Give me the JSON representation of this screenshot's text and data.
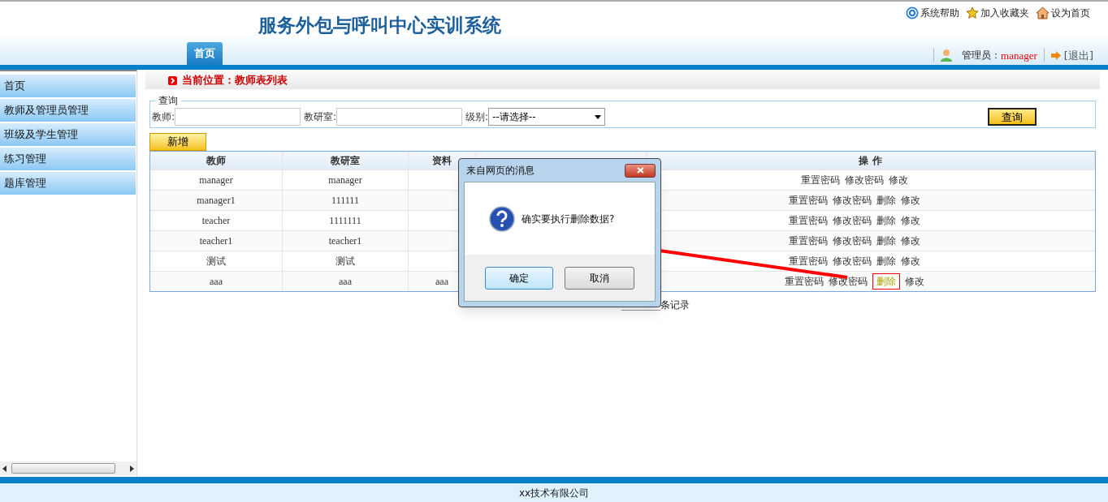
{
  "header": {
    "title": "服务外包与呼叫中心实训系统",
    "links": [
      {
        "label": "系统帮助",
        "kind": "help"
      },
      {
        "label": "加入收藏夹",
        "kind": "favorite"
      },
      {
        "label": "设为首页",
        "kind": "homepage"
      }
    ]
  },
  "tabs": [
    {
      "label": "首页",
      "selected": true
    }
  ],
  "user": {
    "role": "管理员：",
    "name": "manager",
    "logout": "[退出]"
  },
  "sidebar": {
    "items": [
      "首页",
      "教师及管理员管理",
      "班级及学生管理",
      "练习管理",
      "题库管理"
    ]
  },
  "breadcrumb": "当前位置：教师表列表",
  "query": {
    "legend": "查询",
    "fields": [
      {
        "label": "教师:",
        "kind": "text"
      },
      {
        "label": "教研室:",
        "kind": "text"
      },
      {
        "label": "级别:",
        "kind": "select",
        "value": "--请选择--"
      }
    ],
    "button": "查询"
  },
  "add_button": "新增",
  "table": {
    "columns": [
      {
        "kind": "text",
        "label": "教师"
      },
      {
        "kind": "text",
        "label": "教研室"
      },
      {
        "kind": "text",
        "label": "资料"
      },
      {
        "kind": "covered"
      },
      {
        "kind": "text",
        "label": "操 作"
      }
    ],
    "rows": [
      {
        "teacher": "manager",
        "office": "manager",
        "actions": [
          {
            "label": "重置密码",
            "highlighted": false
          },
          {
            "label": "修改密码",
            "highlighted": false
          },
          {
            "label": "修改",
            "highlighted": false
          }
        ]
      },
      {
        "teacher": "manager1",
        "office": "111111",
        "actions": [
          {
            "label": "重置密码",
            "highlighted": false
          },
          {
            "label": "修改密码",
            "highlighted": false
          },
          {
            "label": "删除",
            "highlighted": false
          },
          {
            "label": "修改",
            "highlighted": false
          }
        ]
      },
      {
        "teacher": "teacher",
        "office": "1111111",
        "actions": [
          {
            "label": "重置密码",
            "highlighted": false
          },
          {
            "label": "修改密码",
            "highlighted": false
          },
          {
            "label": "删除",
            "highlighted": false
          },
          {
            "label": "修改",
            "highlighted": false
          }
        ]
      },
      {
        "teacher": "teacher1",
        "office": "teacher1",
        "actions": [
          {
            "label": "重置密码",
            "highlighted": false
          },
          {
            "label": "修改密码",
            "highlighted": false
          },
          {
            "label": "删除",
            "highlighted": false
          },
          {
            "label": "修改",
            "highlighted": false
          }
        ]
      },
      {
        "teacher": "测试",
        "office": "测试",
        "actions": [
          {
            "label": "重置密码",
            "highlighted": false
          },
          {
            "label": "修改密码",
            "highlighted": false
          },
          {
            "label": "删除",
            "highlighted": false
          },
          {
            "label": "修改",
            "highlighted": false
          }
        ]
      },
      {
        "teacher": "aaa",
        "office": "aaa",
        "info": "aaa",
        "actions": [
          {
            "label": "重置密码",
            "highlighted": false
          },
          {
            "label": "修改密码",
            "highlighted": false
          },
          {
            "label": "删除",
            "highlighted": true
          },
          {
            "label": "修改",
            "highlighted": false
          }
        ]
      }
    ]
  },
  "pagination": {
    "suffix": "条记录"
  },
  "dialog": {
    "title": "来自网页的消息",
    "message": "确实要执行删除数据?",
    "buttons": [
      {
        "label": "确定",
        "default": true
      },
      {
        "label": "取消",
        "default": false
      }
    ]
  },
  "footer": "xx技术有限公司"
}
